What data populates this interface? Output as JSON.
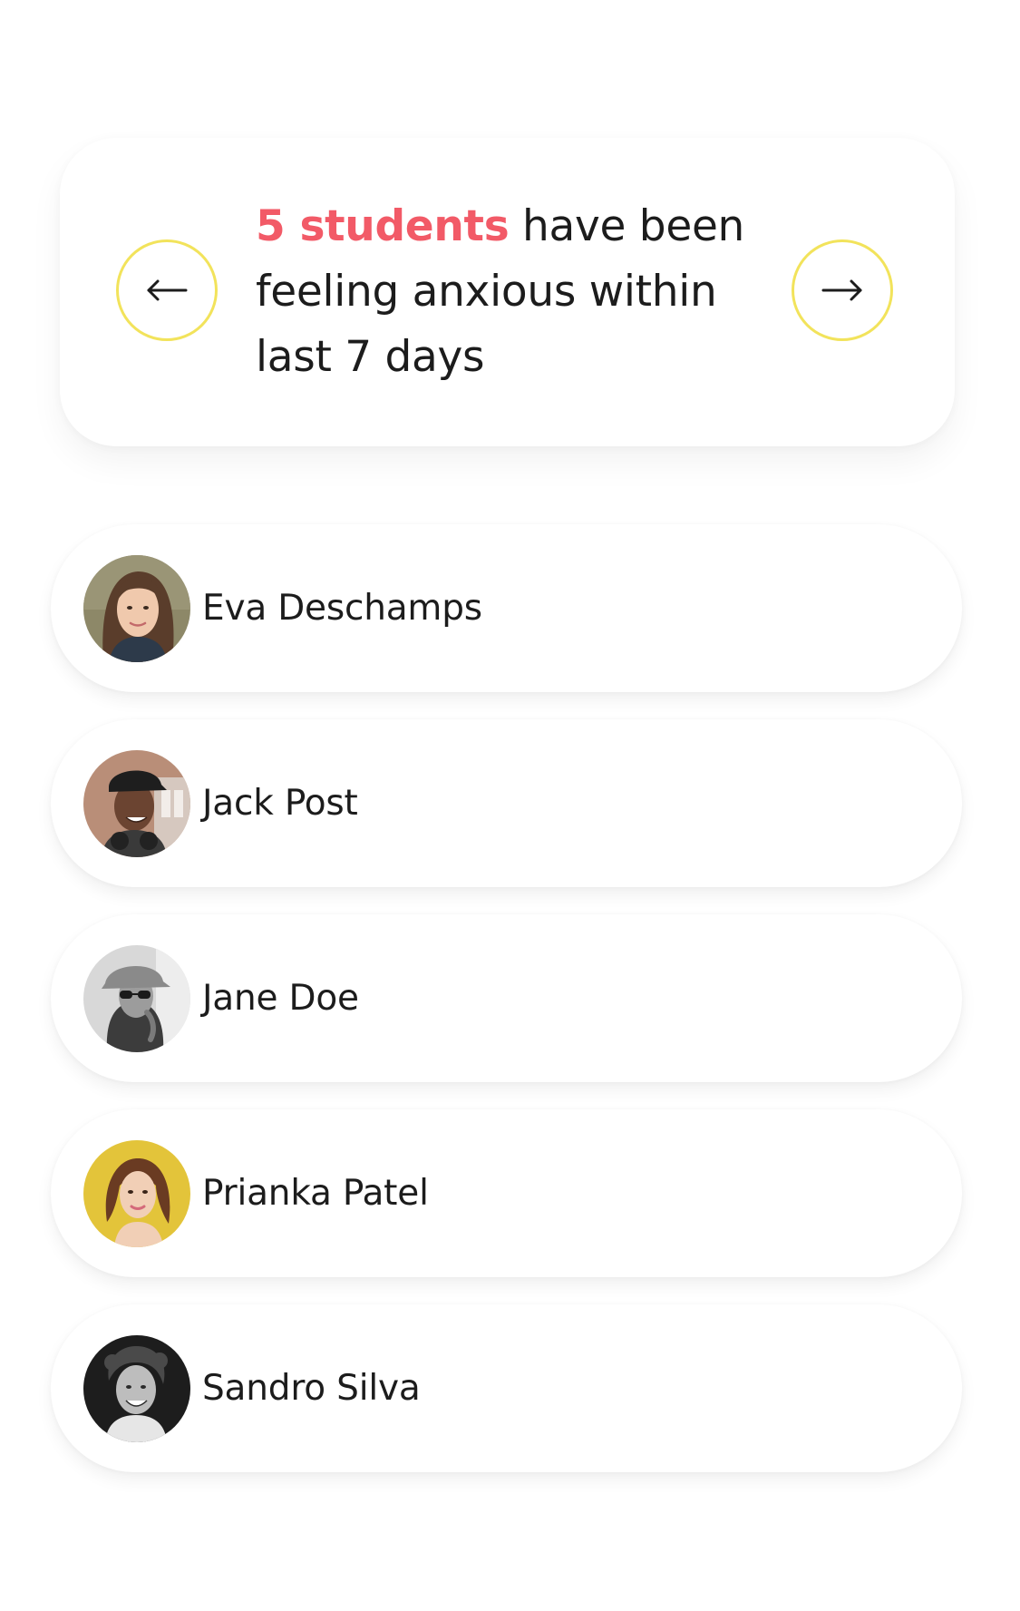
{
  "summary": {
    "highlight": "5 students",
    "message": " have been feeling anxious within last 7 days",
    "highlight_color": "#f25a67",
    "button_border_color": "#f2e35b",
    "prev_icon": "arrow-left-icon",
    "next_icon": "arrow-right-icon"
  },
  "students": [
    {
      "name": "Eva Deschamps",
      "avatar": "avatar-photo"
    },
    {
      "name": "Jack Post",
      "avatar": "avatar-photo"
    },
    {
      "name": "Jane Doe",
      "avatar": "avatar-photo"
    },
    {
      "name": "Prianka Patel",
      "avatar": "avatar-photo"
    },
    {
      "name": "Sandro Silva",
      "avatar": "avatar-photo"
    }
  ]
}
